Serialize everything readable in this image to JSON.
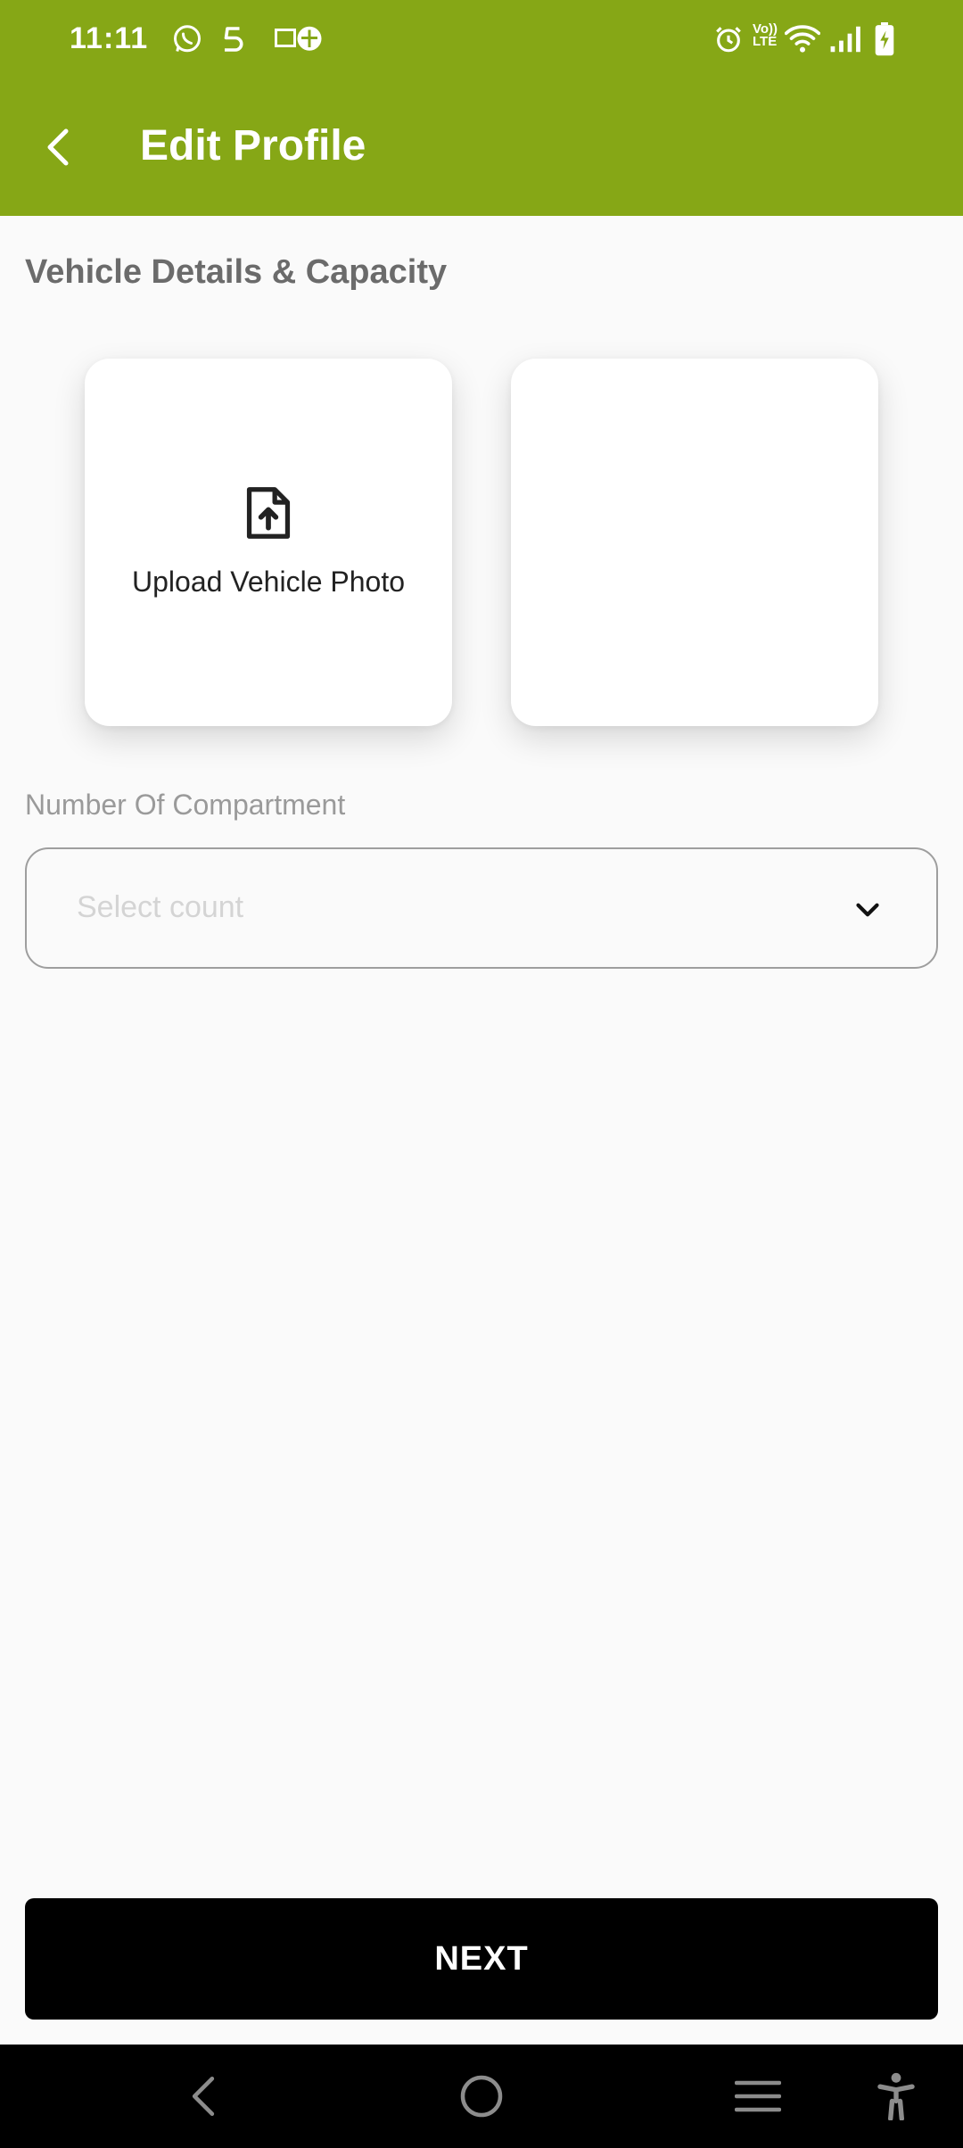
{
  "status_bar": {
    "time": "11:11",
    "left_icons": [
      "whatsapp-icon",
      "s-app-icon",
      "gallery-icon"
    ],
    "right_icons": [
      "alarm-icon",
      "volte-icon",
      "wifi-icon",
      "signal-icon",
      "battery-charging-icon"
    ],
    "volte_text_top": "Vo))",
    "volte_text_bottom": "LTE"
  },
  "app_bar": {
    "title": "Edit Profile",
    "back_icon": "chevron-left-icon"
  },
  "section": {
    "title": "Vehicle Details & Capacity"
  },
  "photos": {
    "upload_label": "Upload Vehicle Photo",
    "upload_icon": "file-upload-icon"
  },
  "compartment": {
    "label": "Number Of Compartment",
    "placeholder": "Select count",
    "chevron_icon": "chevron-down-icon"
  },
  "actions": {
    "next_label": "NEXT"
  },
  "system_nav": {
    "icons": [
      "back-nav-icon",
      "home-nav-icon",
      "recents-nav-icon",
      "accessibility-icon"
    ]
  },
  "colors": {
    "app_bar": "#86a716",
    "background": "#fafafa",
    "button": "#000000"
  }
}
